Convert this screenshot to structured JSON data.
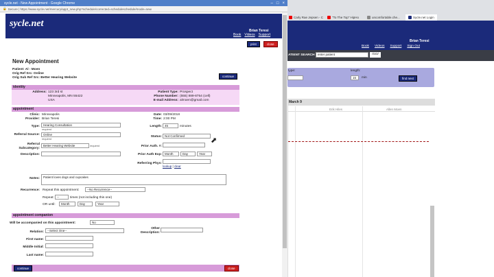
{
  "bg": {
    "tabs": [
      "Carly Rae Jepsen - C",
      "\"To The Top\" HipHo",
      "uncomfortable.che...",
      "Sycle.net Login"
    ],
    "user": "Brian Teresi",
    "nav": [
      "Book",
      "Videos",
      "Support",
      "Sign Out"
    ],
    "search_label": "ATIENT SEARCH",
    "search_placeholder": "enter patient",
    "go": "/GO/",
    "type_label": "type:",
    "length_label": "length:",
    "length_value": "15",
    "min": "min",
    "find_next": "find next",
    "date": "March 9",
    "cols": [
      "Erik Hiles",
      "Allen Moen"
    ]
  },
  "window": {
    "title": "sycle.net - New Appointment - Google Chrome",
    "url": "Secure | https://www.sycle.net/mercury/appt_new.php?schedule/corrected=scheduleschedule/mode=new"
  },
  "header": {
    "logo": "sycle.net",
    "user": "Brian Teresi",
    "nav": [
      "Book",
      "Videos",
      "Support"
    ]
  },
  "actions": {
    "print": "print",
    "close": "close",
    "continue": "continue"
  },
  "page": {
    "title": "New Appointment",
    "patient": "Patient: Al - Moen",
    "ref_src": "Orig Ref Src: Online",
    "sub_src": "Orig Sub Ref Src: Better Hearing Website"
  },
  "identity": {
    "heading": "identity",
    "address_label": "Address:",
    "address": [
      "123 3rd st",
      "Minneapolis, MN 55422",
      "USA"
    ],
    "patient_type_label": "Patient Type:",
    "patient_type": "Prospect",
    "phone_label": "Phone Number:",
    "phone": "(555) 889-8754 (cell)",
    "email_label": "E-mail Address:",
    "email": "almoen@gmail.com"
  },
  "appointment": {
    "heading": "appointment",
    "clinic_label": "Clinic:",
    "clinic": "Minneapolis",
    "provider_label": "Provider:",
    "provider": "Brian Teresi",
    "type_label": "Type:",
    "type": "Hearing Consultation",
    "required": "required",
    "referral_source_label": "Referral Source:",
    "referral_source": "Online",
    "referral_sub_label": "Referral Subcategory:",
    "referral_sub": "Better Hearing Website",
    "description_label": "Description:",
    "date_label": "Date:",
    "date": "03/09/2018",
    "time_label": "Time:",
    "time": "2:00 PM",
    "length_label": "Length:",
    "length": "45",
    "minutes": "minutes",
    "status_label": "Status:",
    "status": "Not Confirmed",
    "prior_auth_label": "Prior Auth. #:",
    "prior_exp_label": "Prior Auth Exp:",
    "month": "Month",
    "day": "Day",
    "year": "Year",
    "ref_phys_label": "Referring Phys:",
    "lookup": "lookup",
    "clear": "clear",
    "notes_label": "Notes:",
    "notes": "Patient loves dogs and cupcakes",
    "recurrence_label": "Recurrence:",
    "repeat_this": "Repeat this appointment:",
    "no_recurrence": "--No Recurrence--",
    "repeat_label": "Repeat:",
    "repeat_value": "--",
    "times_text": "times (not including this one)",
    "or_until": "OR until:"
  },
  "companion": {
    "heading": "appointment companion",
    "accompanied_label": "Will be accompanied on this appointment:",
    "accompanied": "No",
    "relation_label": "Relation:",
    "relation": "--Select One--",
    "other_label": "Other Description:",
    "first_label": "First name:",
    "middle_label": "Middle Initial:",
    "last_label": "Last name:"
  }
}
